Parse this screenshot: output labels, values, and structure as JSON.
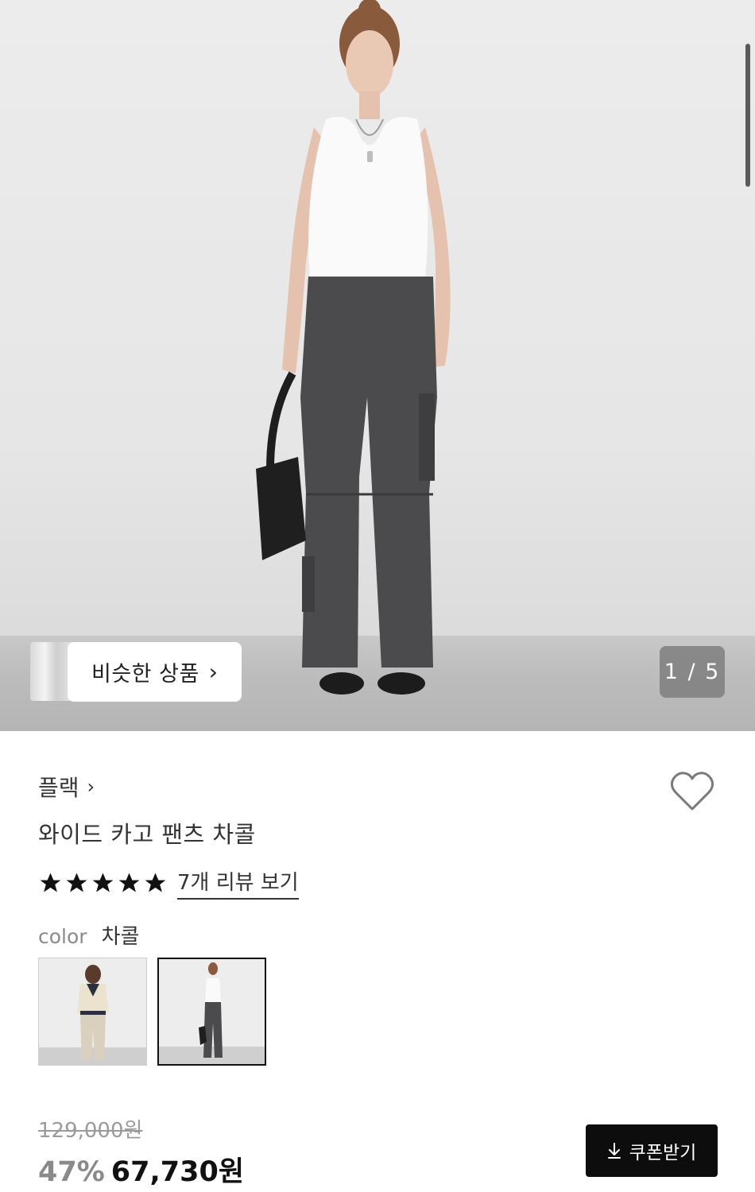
{
  "gallery": {
    "similar_label": "비슷한 상품",
    "counter": "1 / 5",
    "current_index": 1,
    "total_images": 5
  },
  "product": {
    "brand": "플랙",
    "title": "와이드 카고 팬츠 차콜",
    "rating": {
      "stars": 5,
      "max_stars": 5,
      "review_link": "7개 리뷰 보기"
    },
    "color": {
      "key": "color",
      "value": "차콜"
    },
    "swatches": [
      {
        "name": "cream",
        "selected": false
      },
      {
        "name": "charcoal",
        "selected": true
      }
    ],
    "price": {
      "original": "129,000원",
      "discount": "47%",
      "final": "67,730원"
    },
    "coupon_label": "쿠폰받기"
  },
  "icons": {
    "heart": "heart-icon",
    "star": "star-icon",
    "chevron": "chevron-right-icon",
    "download": "download-icon"
  },
  "colors": {
    "accent": "#0d0d0d",
    "muted": "#8a8a8a"
  }
}
